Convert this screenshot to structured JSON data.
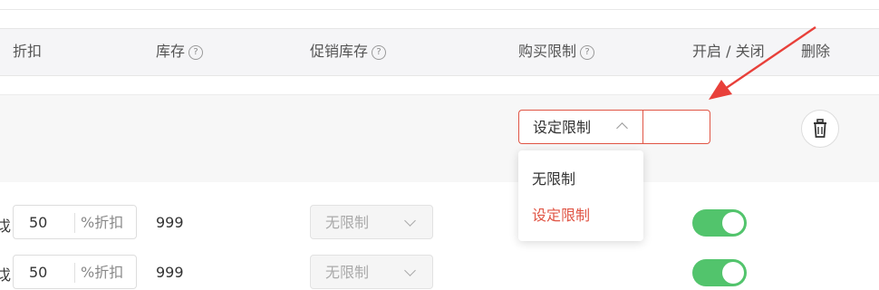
{
  "header": {
    "discount": "折扣",
    "stock": "库存",
    "promo_stock": "促销库存",
    "purchase_limit": "购买限制",
    "enable_close": "开启 / 关闭",
    "delete": "删除",
    "help_glyph": "?"
  },
  "batch_row": {
    "limit_select_value": "设定限制",
    "limit_input_value": ""
  },
  "limit_dropdown": {
    "options": [
      "无限制",
      "设定限制"
    ],
    "selected_color": "#e05545"
  },
  "rows": [
    {
      "cut_text": "戉",
      "discount_value": "50",
      "discount_suffix": "%折扣",
      "stock": "999",
      "promo_stock": "无限制",
      "enabled": true
    },
    {
      "cut_text": "戉",
      "discount_value": "50",
      "discount_suffix": "%折扣",
      "stock": "999",
      "promo_stock": "无限制",
      "enabled": true
    }
  ],
  "colors": {
    "accent_red": "#e05545",
    "toggle_on": "#52c46c",
    "annotation_arrow": "#e8403a"
  },
  "icons": {
    "trash": "trash-icon",
    "help": "help-circle-icon",
    "chevron_up": "chevron-up-icon",
    "chevron_down": "chevron-down-icon"
  }
}
